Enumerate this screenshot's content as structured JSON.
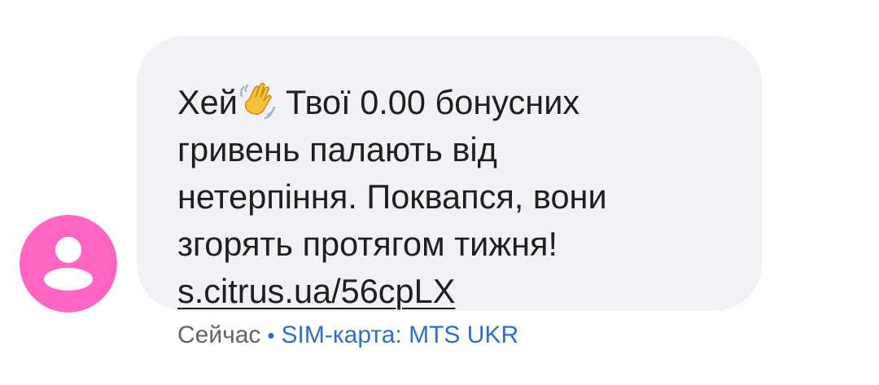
{
  "message": {
    "line1_before_icon": "Хей",
    "wave_icon": "waving-hand-emoji",
    "line1_after_icon": "Твої 0.00 бонусних",
    "line2": "гривень палають від",
    "line3": "нетерпіння. Поквапся, вони",
    "line4": "згорять протягом тижня!",
    "link": "s.citrus.ua/56cpLX"
  },
  "meta": {
    "time": "Сейчас",
    "separator": "•",
    "sim": "SIM-карта: MTS UKR"
  },
  "avatar": {
    "icon": "person-icon",
    "background_color": "#ff66c4",
    "icon_color": "#ffffff"
  },
  "colors": {
    "bubble_background": "#f1f2f6",
    "text": "#1f1f1f",
    "meta_time": "#626468",
    "meta_sim": "#2f6cd4"
  }
}
